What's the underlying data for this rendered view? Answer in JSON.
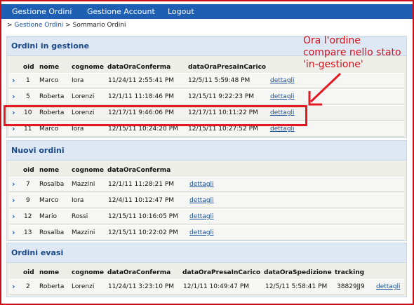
{
  "nav": {
    "items": [
      "Gestione Ordini",
      "Gestione Account",
      "Logout"
    ]
  },
  "breadcrumb": {
    "prefix": ">",
    "link": "Gestione Ordini",
    "separator": ">",
    "current": "Sommario Ordini"
  },
  "panels": {
    "ingestione": {
      "title": "Ordini in gestione",
      "columns": [
        "oid",
        "nome",
        "cognome",
        "dataOraConferma",
        "dataOraPresaInCarico"
      ],
      "rows": [
        {
          "oid": "1",
          "nome": "Marco",
          "cognome": "Iora",
          "conferma": "11/24/11 2:55:41 PM",
          "presa": "12/5/11 5:59:48 PM",
          "link": "dettagli"
        },
        {
          "oid": "5",
          "nome": "Roberta",
          "cognome": "Lorenzi",
          "conferma": "12/1/11 11:18:46 PM",
          "presa": "12/15/11 9:22:23 PM",
          "link": "dettagli"
        },
        {
          "oid": "10",
          "nome": "Roberta",
          "cognome": "Lorenzi",
          "conferma": "12/17/11 9:46:06 PM",
          "presa": "12/17/11 10:11:22 PM",
          "link": "dettagli"
        },
        {
          "oid": "11",
          "nome": "Marco",
          "cognome": "Iora",
          "conferma": "12/15/11 10:24:20 PM",
          "presa": "12/15/11 10:27:52 PM",
          "link": "dettagli"
        }
      ]
    },
    "nuovi": {
      "title": "Nuovi ordini",
      "columns": [
        "oid",
        "nome",
        "cognome",
        "dataOraConferma"
      ],
      "rows": [
        {
          "oid": "7",
          "nome": "Rosalba",
          "cognome": "Mazzini",
          "conferma": "12/1/11 11:28:21 PM",
          "link": "dettagli"
        },
        {
          "oid": "9",
          "nome": "Marco",
          "cognome": "Iora",
          "conferma": "12/4/11 10:12:47 PM",
          "link": "dettagli"
        },
        {
          "oid": "12",
          "nome": "Mario",
          "cognome": "Rossi",
          "conferma": "12/15/11 10:16:05 PM",
          "link": "dettagli"
        },
        {
          "oid": "13",
          "nome": "Rosalba",
          "cognome": "Mazzini",
          "conferma": "12/15/11 10:22:02 PM",
          "link": "dettagli"
        }
      ]
    },
    "evasi": {
      "title": "Ordini evasi",
      "columns": [
        "oid",
        "nome",
        "cognome",
        "dataOraConferma",
        "dataOraPresaInCarico",
        "dataOraSpedizione",
        "tracking"
      ],
      "rows": [
        {
          "oid": "2",
          "nome": "Roberta",
          "cognome": "Lorenzi",
          "conferma": "11/24/11 3:23:10 PM",
          "presa": "12/1/11 10:49:47 PM",
          "spedizione": "12/5/11 5:58:41 PM",
          "tracking": "38829JJ9",
          "link": "dettagli"
        }
      ]
    }
  },
  "annotation": {
    "lines": [
      "Ora l'ordine",
      "compare nello stato",
      "'in-gestione'"
    ],
    "color": "#d8101a"
  },
  "colors": {
    "nav": "#1f5fb3",
    "panel_title": "#1a4a8a",
    "highlight": "#e11a22",
    "link": "#1a4f9c"
  }
}
